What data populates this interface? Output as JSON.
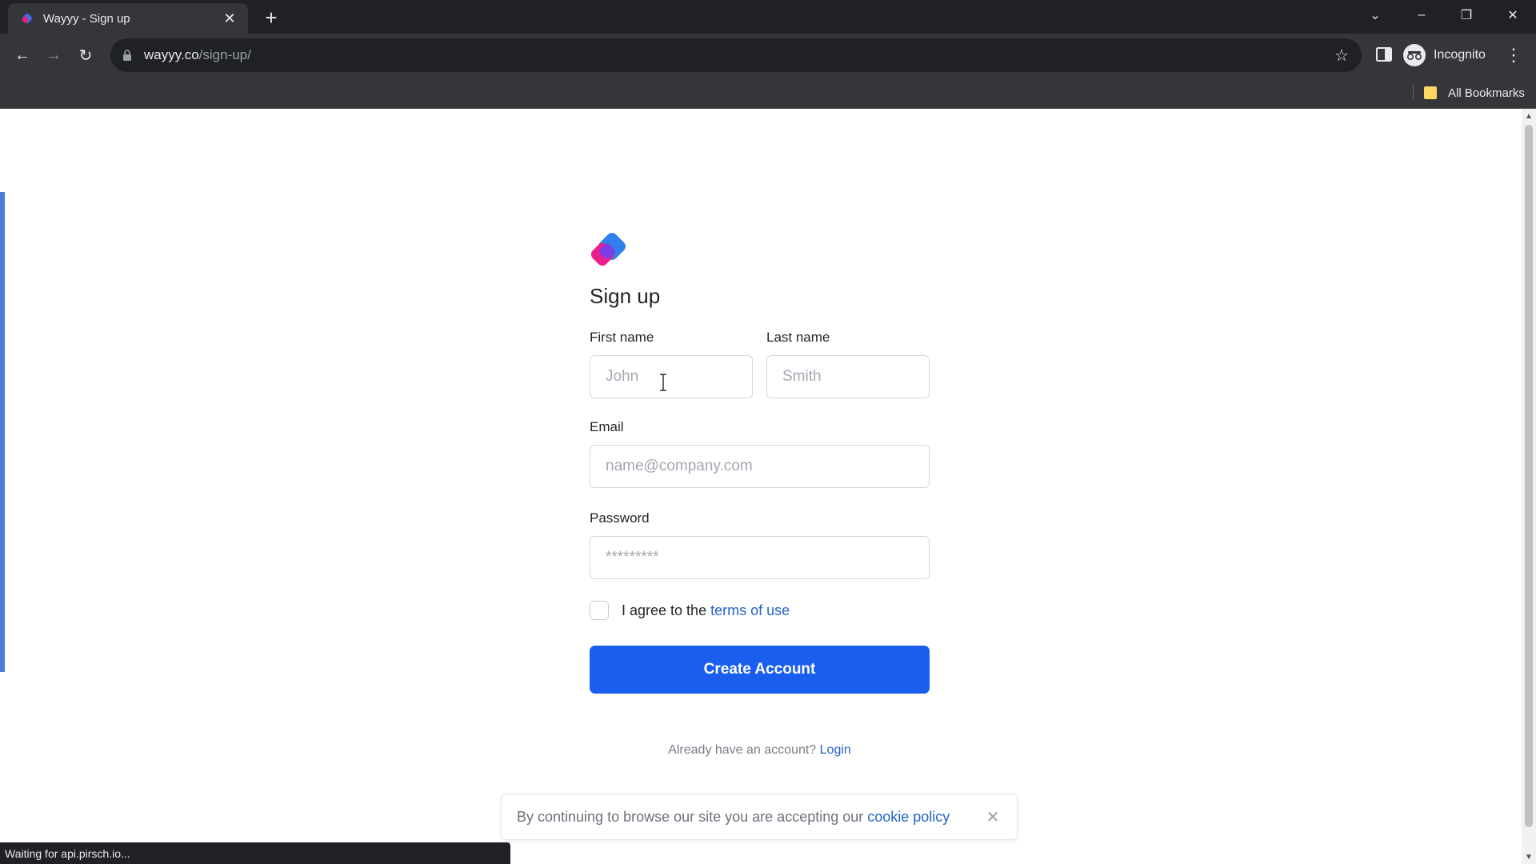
{
  "browser": {
    "tab_title": "Wayyy - Sign up",
    "url_host": "wayyy.co",
    "url_path": "/sign-up/",
    "profile_label": "Incognito",
    "bookmarks_label": "All Bookmarks",
    "status_text": "Waiting for api.pirsch.io..."
  },
  "icons": {
    "back": "arrow-left",
    "forward": "arrow-right",
    "reload": "reload",
    "new_tab": "plus",
    "close": "close",
    "star": "star",
    "menu": "vertical-dots"
  },
  "form": {
    "heading": "Sign up",
    "first_name": {
      "label": "First name",
      "placeholder": "John",
      "value": ""
    },
    "last_name": {
      "label": "Last name",
      "placeholder": "Smith",
      "value": ""
    },
    "email": {
      "label": "Email",
      "placeholder": "name@company.com",
      "value": ""
    },
    "password": {
      "label": "Password",
      "placeholder": "*********",
      "value": ""
    },
    "agree_prefix": "I agree to the ",
    "agree_link": "terms of use",
    "agree_checked": false,
    "submit_label": "Create Account",
    "login_prefix": "Already have an account? ",
    "login_link": "Login"
  },
  "cookie": {
    "prefix": "By continuing to browse our site you are accepting our ",
    "link": "cookie policy"
  },
  "colors": {
    "primary": "#1a5ef0",
    "link": "#2563c7",
    "logo_blue": "#2f80ed",
    "logo_pink": "#ea1e8c"
  }
}
